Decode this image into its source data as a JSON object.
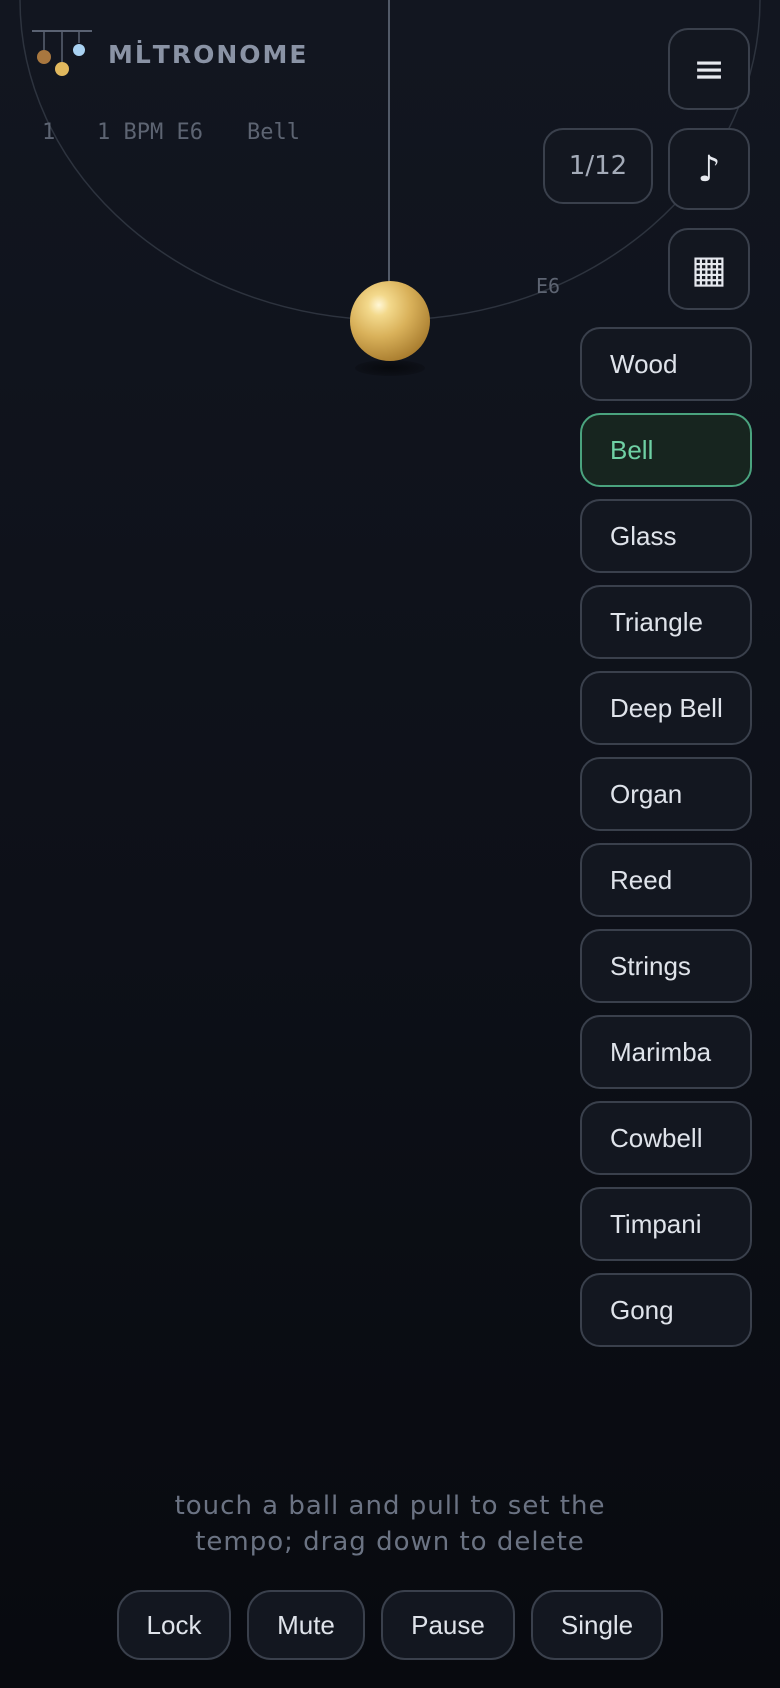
{
  "app": {
    "brand": "ML̇TRONOME"
  },
  "status": {
    "count": "1",
    "bpm": "1 BPM E6",
    "sound": "Bell"
  },
  "pendulum": {
    "note_label": "E6",
    "ball_color": "#d9b15a"
  },
  "toolbar": {
    "menu_icon": "menu-icon",
    "menu_glyph": "≡",
    "counter": "1/12",
    "note_icon": "music-note-icon",
    "note_glyph": "♪",
    "grid_icon": "grid-icon",
    "grid_glyph": "▦"
  },
  "sounds": [
    {
      "label": "Wood",
      "active": false
    },
    {
      "label": "Bell",
      "active": true
    },
    {
      "label": "Glass",
      "active": false
    },
    {
      "label": "Triangle",
      "active": false
    },
    {
      "label": "Deep Bell",
      "active": false
    },
    {
      "label": "Organ",
      "active": false
    },
    {
      "label": "Reed",
      "active": false
    },
    {
      "label": "Strings",
      "active": false
    },
    {
      "label": "Marimba",
      "active": false
    },
    {
      "label": "Cowbell",
      "active": false
    },
    {
      "label": "Timpani",
      "active": false
    },
    {
      "label": "Gong",
      "active": false
    }
  ],
  "hint": {
    "line1": "touch a ball and pull to set the",
    "line2": "tempo; drag down to delete"
  },
  "controls": {
    "lock": "Lock",
    "mute": "Mute",
    "pause": "Pause",
    "single": "Single"
  },
  "colors": {
    "accent": "#4aa37e",
    "accent_text": "#6fd0a4",
    "background": "#0d1018"
  }
}
